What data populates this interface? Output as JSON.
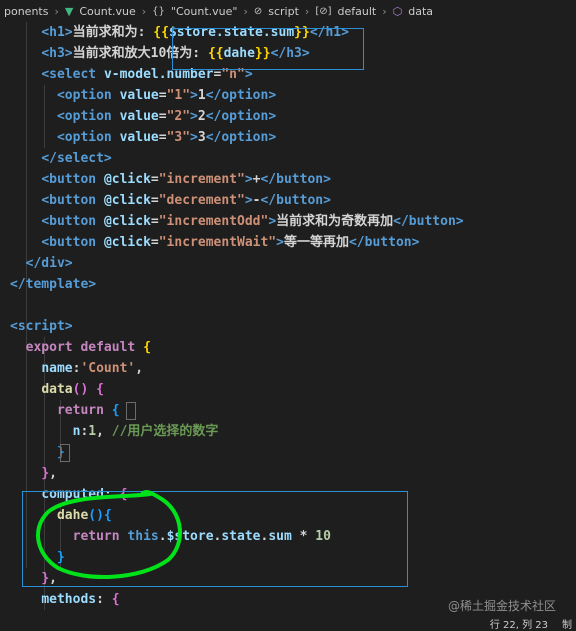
{
  "breadcrumb": {
    "folder": "ponents",
    "file": "Count.vue",
    "template": "\"Count.vue\"",
    "script": "script",
    "default": "default",
    "data": "data"
  },
  "editor": {
    "lines": [
      [
        [
          "pu",
          "    "
        ],
        [
          "k",
          "<h1>"
        ],
        [
          "tx",
          "当前求和为: "
        ],
        [
          "yb",
          "{{"
        ],
        [
          "at",
          "$store.state.sum"
        ],
        [
          "yb",
          "}}"
        ],
        [
          "k",
          "</h1>"
        ]
      ],
      [
        [
          "pu",
          "    "
        ],
        [
          "k",
          "<h3>"
        ],
        [
          "tx",
          "当前求和放大10倍为: "
        ],
        [
          "yb",
          "{{"
        ],
        [
          "at",
          "dahe"
        ],
        [
          "yb",
          "}}"
        ],
        [
          "k",
          "</h3>"
        ]
      ],
      [
        [
          "pu",
          "    "
        ],
        [
          "k",
          "<select "
        ],
        [
          "at",
          "v-model.number"
        ],
        [
          "pu",
          "="
        ],
        [
          "st",
          "\"n\""
        ],
        [
          "k",
          ">"
        ]
      ],
      [
        [
          "pu",
          "      "
        ],
        [
          "k",
          "<option "
        ],
        [
          "at",
          "value"
        ],
        [
          "pu",
          "="
        ],
        [
          "st",
          "\"1\""
        ],
        [
          "k",
          ">"
        ],
        [
          "tx",
          "1"
        ],
        [
          "k",
          "</option>"
        ]
      ],
      [
        [
          "pu",
          "      "
        ],
        [
          "k",
          "<option "
        ],
        [
          "at",
          "value"
        ],
        [
          "pu",
          "="
        ],
        [
          "st",
          "\"2\""
        ],
        [
          "k",
          ">"
        ],
        [
          "tx",
          "2"
        ],
        [
          "k",
          "</option>"
        ]
      ],
      [
        [
          "pu",
          "      "
        ],
        [
          "k",
          "<option "
        ],
        [
          "at",
          "value"
        ],
        [
          "pu",
          "="
        ],
        [
          "st",
          "\"3\""
        ],
        [
          "k",
          ">"
        ],
        [
          "tx",
          "3"
        ],
        [
          "k",
          "</option>"
        ]
      ],
      [
        [
          "pu",
          "    "
        ],
        [
          "k",
          "</select>"
        ]
      ],
      [
        [
          "pu",
          "    "
        ],
        [
          "k",
          "<button "
        ],
        [
          "at",
          "@click"
        ],
        [
          "pu",
          "="
        ],
        [
          "st",
          "\"increment\""
        ],
        [
          "k",
          ">"
        ],
        [
          "tx",
          "+"
        ],
        [
          "k",
          "</button>"
        ]
      ],
      [
        [
          "pu",
          "    "
        ],
        [
          "k",
          "<button "
        ],
        [
          "at",
          "@click"
        ],
        [
          "pu",
          "="
        ],
        [
          "st",
          "\"decrement\""
        ],
        [
          "k",
          ">"
        ],
        [
          "tx",
          "-"
        ],
        [
          "k",
          "</button>"
        ]
      ],
      [
        [
          "pu",
          "    "
        ],
        [
          "k",
          "<button "
        ],
        [
          "at",
          "@click"
        ],
        [
          "pu",
          "="
        ],
        [
          "st",
          "\"incrementOdd\""
        ],
        [
          "k",
          ">"
        ],
        [
          "tx",
          "当前求和为奇数再加"
        ],
        [
          "k",
          "</button>"
        ]
      ],
      [
        [
          "pu",
          "    "
        ],
        [
          "k",
          "<button "
        ],
        [
          "at",
          "@click"
        ],
        [
          "pu",
          "="
        ],
        [
          "st",
          "\"incrementWait\""
        ],
        [
          "k",
          ">"
        ],
        [
          "tx",
          "等一等再加"
        ],
        [
          "k",
          "</button>"
        ]
      ],
      [
        [
          "pu",
          "  "
        ],
        [
          "k",
          "</div>"
        ]
      ],
      [
        [
          "k",
          "</template>"
        ]
      ],
      [
        [
          "pu",
          ""
        ]
      ],
      [
        [
          "k",
          "<script>"
        ]
      ],
      [
        [
          "pu",
          "  "
        ],
        [
          "pk",
          "export default "
        ],
        [
          "yb",
          "{"
        ]
      ],
      [
        [
          "pu",
          "    "
        ],
        [
          "at",
          "name"
        ],
        [
          "pu",
          ":"
        ],
        [
          "st",
          "'Count'"
        ],
        [
          "pu",
          ","
        ]
      ],
      [
        [
          "pu",
          "    "
        ],
        [
          "fn",
          "data"
        ],
        [
          "pb",
          "()"
        ],
        [
          "pu",
          " "
        ],
        [
          "pb",
          "{"
        ]
      ],
      [
        [
          "pu",
          "      "
        ],
        [
          "pk",
          "return "
        ],
        [
          "bb",
          "{"
        ]
      ],
      [
        [
          "pu",
          "        "
        ],
        [
          "at",
          "n"
        ],
        [
          "pu",
          ":"
        ],
        [
          "nm",
          "1"
        ],
        [
          "pu",
          ", "
        ],
        [
          "cm",
          "//用户选择的数字"
        ]
      ],
      [
        [
          "pu",
          "      "
        ],
        [
          "bb",
          "}"
        ]
      ],
      [
        [
          "pu",
          "    "
        ],
        [
          "pb",
          "}"
        ],
        [
          "pu",
          ","
        ]
      ],
      [
        [
          "pu",
          "    "
        ],
        [
          "at",
          "computed"
        ],
        [
          "pu",
          ": "
        ],
        [
          "pb",
          "{"
        ]
      ],
      [
        [
          "pu",
          "      "
        ],
        [
          "fn",
          "dahe"
        ],
        [
          "bb",
          "()"
        ],
        [
          "bb",
          "{"
        ]
      ],
      [
        [
          "pu",
          "        "
        ],
        [
          "pk",
          "return "
        ],
        [
          "k",
          "this"
        ],
        [
          "pu",
          "."
        ],
        [
          "at",
          "$store"
        ],
        [
          "pu",
          "."
        ],
        [
          "at",
          "state"
        ],
        [
          "pu",
          "."
        ],
        [
          "at",
          "sum"
        ],
        [
          "pu",
          " * "
        ],
        [
          "nm",
          "10"
        ]
      ],
      [
        [
          "pu",
          "      "
        ],
        [
          "bb",
          "}"
        ]
      ],
      [
        [
          "pu",
          "    "
        ],
        [
          "pb",
          "}"
        ],
        [
          "pu",
          ","
        ]
      ],
      [
        [
          "pu",
          "    "
        ],
        [
          "at",
          "methods"
        ],
        [
          "pu",
          ": "
        ],
        [
          "pb",
          "{"
        ]
      ]
    ]
  },
  "watermark": "@稀土掘金技术社区",
  "status": {
    "position": "行 22, 列 23",
    "extra": "制"
  }
}
